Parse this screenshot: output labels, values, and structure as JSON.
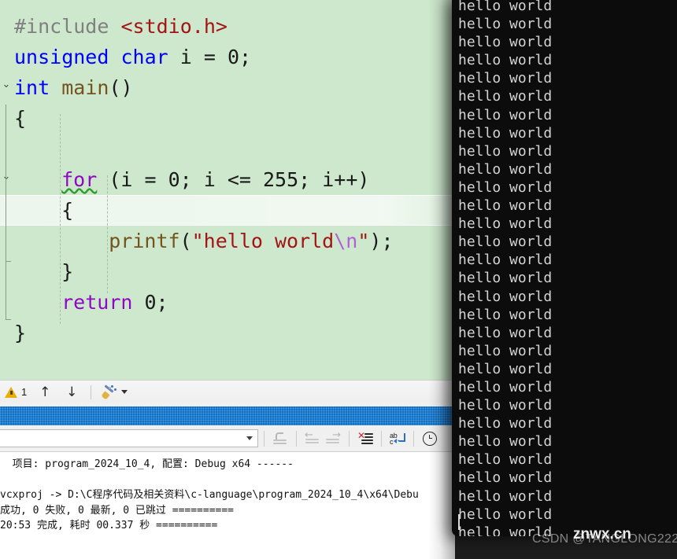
{
  "editor": {
    "background_hex": "#cde8cd",
    "current_line_index": 6,
    "lines": [
      {
        "indent": 0,
        "tokens": [
          {
            "t": "#include ",
            "c": "tk-pre"
          },
          {
            "t": "<stdio.h>",
            "c": "tk-inc"
          }
        ]
      },
      {
        "indent": 0,
        "tokens": [
          {
            "t": "unsigned char",
            "c": "tk-kw"
          },
          {
            "t": " i = ",
            "c": "tk-plain"
          },
          {
            "t": "0",
            "c": "tk-num"
          },
          {
            "t": ";",
            "c": "tk-plain"
          }
        ]
      },
      {
        "indent": 0,
        "tokens": [
          {
            "t": "int",
            "c": "tk-kw"
          },
          {
            "t": " ",
            "c": "tk-plain"
          },
          {
            "t": "main",
            "c": "tk-fn"
          },
          {
            "t": "()",
            "c": "tk-plain"
          }
        ]
      },
      {
        "indent": 0,
        "tokens": [
          {
            "t": "{",
            "c": "tk-plain"
          }
        ]
      },
      {
        "indent": 0,
        "tokens": []
      },
      {
        "indent": 1,
        "tokens": [
          {
            "t": "for",
            "c": "tk-kw2 tk-warnsq"
          },
          {
            "t": " (i = ",
            "c": "tk-plain"
          },
          {
            "t": "0",
            "c": "tk-num"
          },
          {
            "t": "; i <= ",
            "c": "tk-plain"
          },
          {
            "t": "255",
            "c": "tk-num"
          },
          {
            "t": "; i++)",
            "c": "tk-plain"
          }
        ]
      },
      {
        "indent": 1,
        "tokens": [
          {
            "t": "{",
            "c": "tk-plain"
          }
        ]
      },
      {
        "indent": 2,
        "tokens": [
          {
            "t": "printf",
            "c": "tk-fn"
          },
          {
            "t": "(",
            "c": "tk-plain"
          },
          {
            "t": "\"hello world",
            "c": "tk-str"
          },
          {
            "t": "\\n",
            "c": "tk-esc"
          },
          {
            "t": "\"",
            "c": "tk-str"
          },
          {
            "t": ");",
            "c": "tk-plain"
          }
        ]
      },
      {
        "indent": 1,
        "tokens": [
          {
            "t": "}",
            "c": "tk-plain"
          }
        ]
      },
      {
        "indent": 1,
        "tokens": [
          {
            "t": "return",
            "c": "tk-kw2"
          },
          {
            "t": " ",
            "c": "tk-plain"
          },
          {
            "t": "0",
            "c": "tk-num"
          },
          {
            "t": ";",
            "c": "tk-plain"
          }
        ]
      },
      {
        "indent": 0,
        "tokens": [
          {
            "t": "}",
            "c": "tk-plain"
          }
        ]
      }
    ]
  },
  "error_bar": {
    "warning_count": "1",
    "prev_arrow": "↑",
    "next_arrow": "↓",
    "icons": {
      "warning": "warning-triangle-icon",
      "previous": "arrow-up-icon",
      "next": "arrow-down-icon",
      "cleanup": "broom-code-cleanup-icon",
      "cleanup_dropdown": "chevron-down-icon"
    }
  },
  "output_toolbar": {
    "combo_value": "",
    "combo_placeholder": "",
    "buttons": [
      {
        "name": "go-to-message-source-button",
        "enabled": false
      },
      {
        "name": "previous-message-button",
        "enabled": false
      },
      {
        "name": "next-message-button",
        "enabled": false
      },
      {
        "name": "clear-all-button",
        "enabled": true
      },
      {
        "name": "toggle-word-wrap-button",
        "enabled": true
      },
      {
        "name": "toggle-timestamps-button",
        "enabled": true
      }
    ]
  },
  "output_pane": {
    "lines": [
      "  项目: program_2024_10_4, 配置: Debug x64 ------",
      "",
      "vcxproj -> D:\\C程序代码及相关资料\\c-language\\program_2024_10_4\\x64\\Debu",
      "成功, 0 失败, 0 最新, 0 已跳过 ==========",
      "20:53 完成, 耗时 00.337 秒 =========="
    ]
  },
  "console": {
    "background_hex": "#0c0c0c",
    "text_hex": "#d4d4d4",
    "line_text": "hello world",
    "line_count": 30
  },
  "watermark": {
    "csdn": "CSDN @TANGLONG222",
    "site": "znwx.cn"
  }
}
